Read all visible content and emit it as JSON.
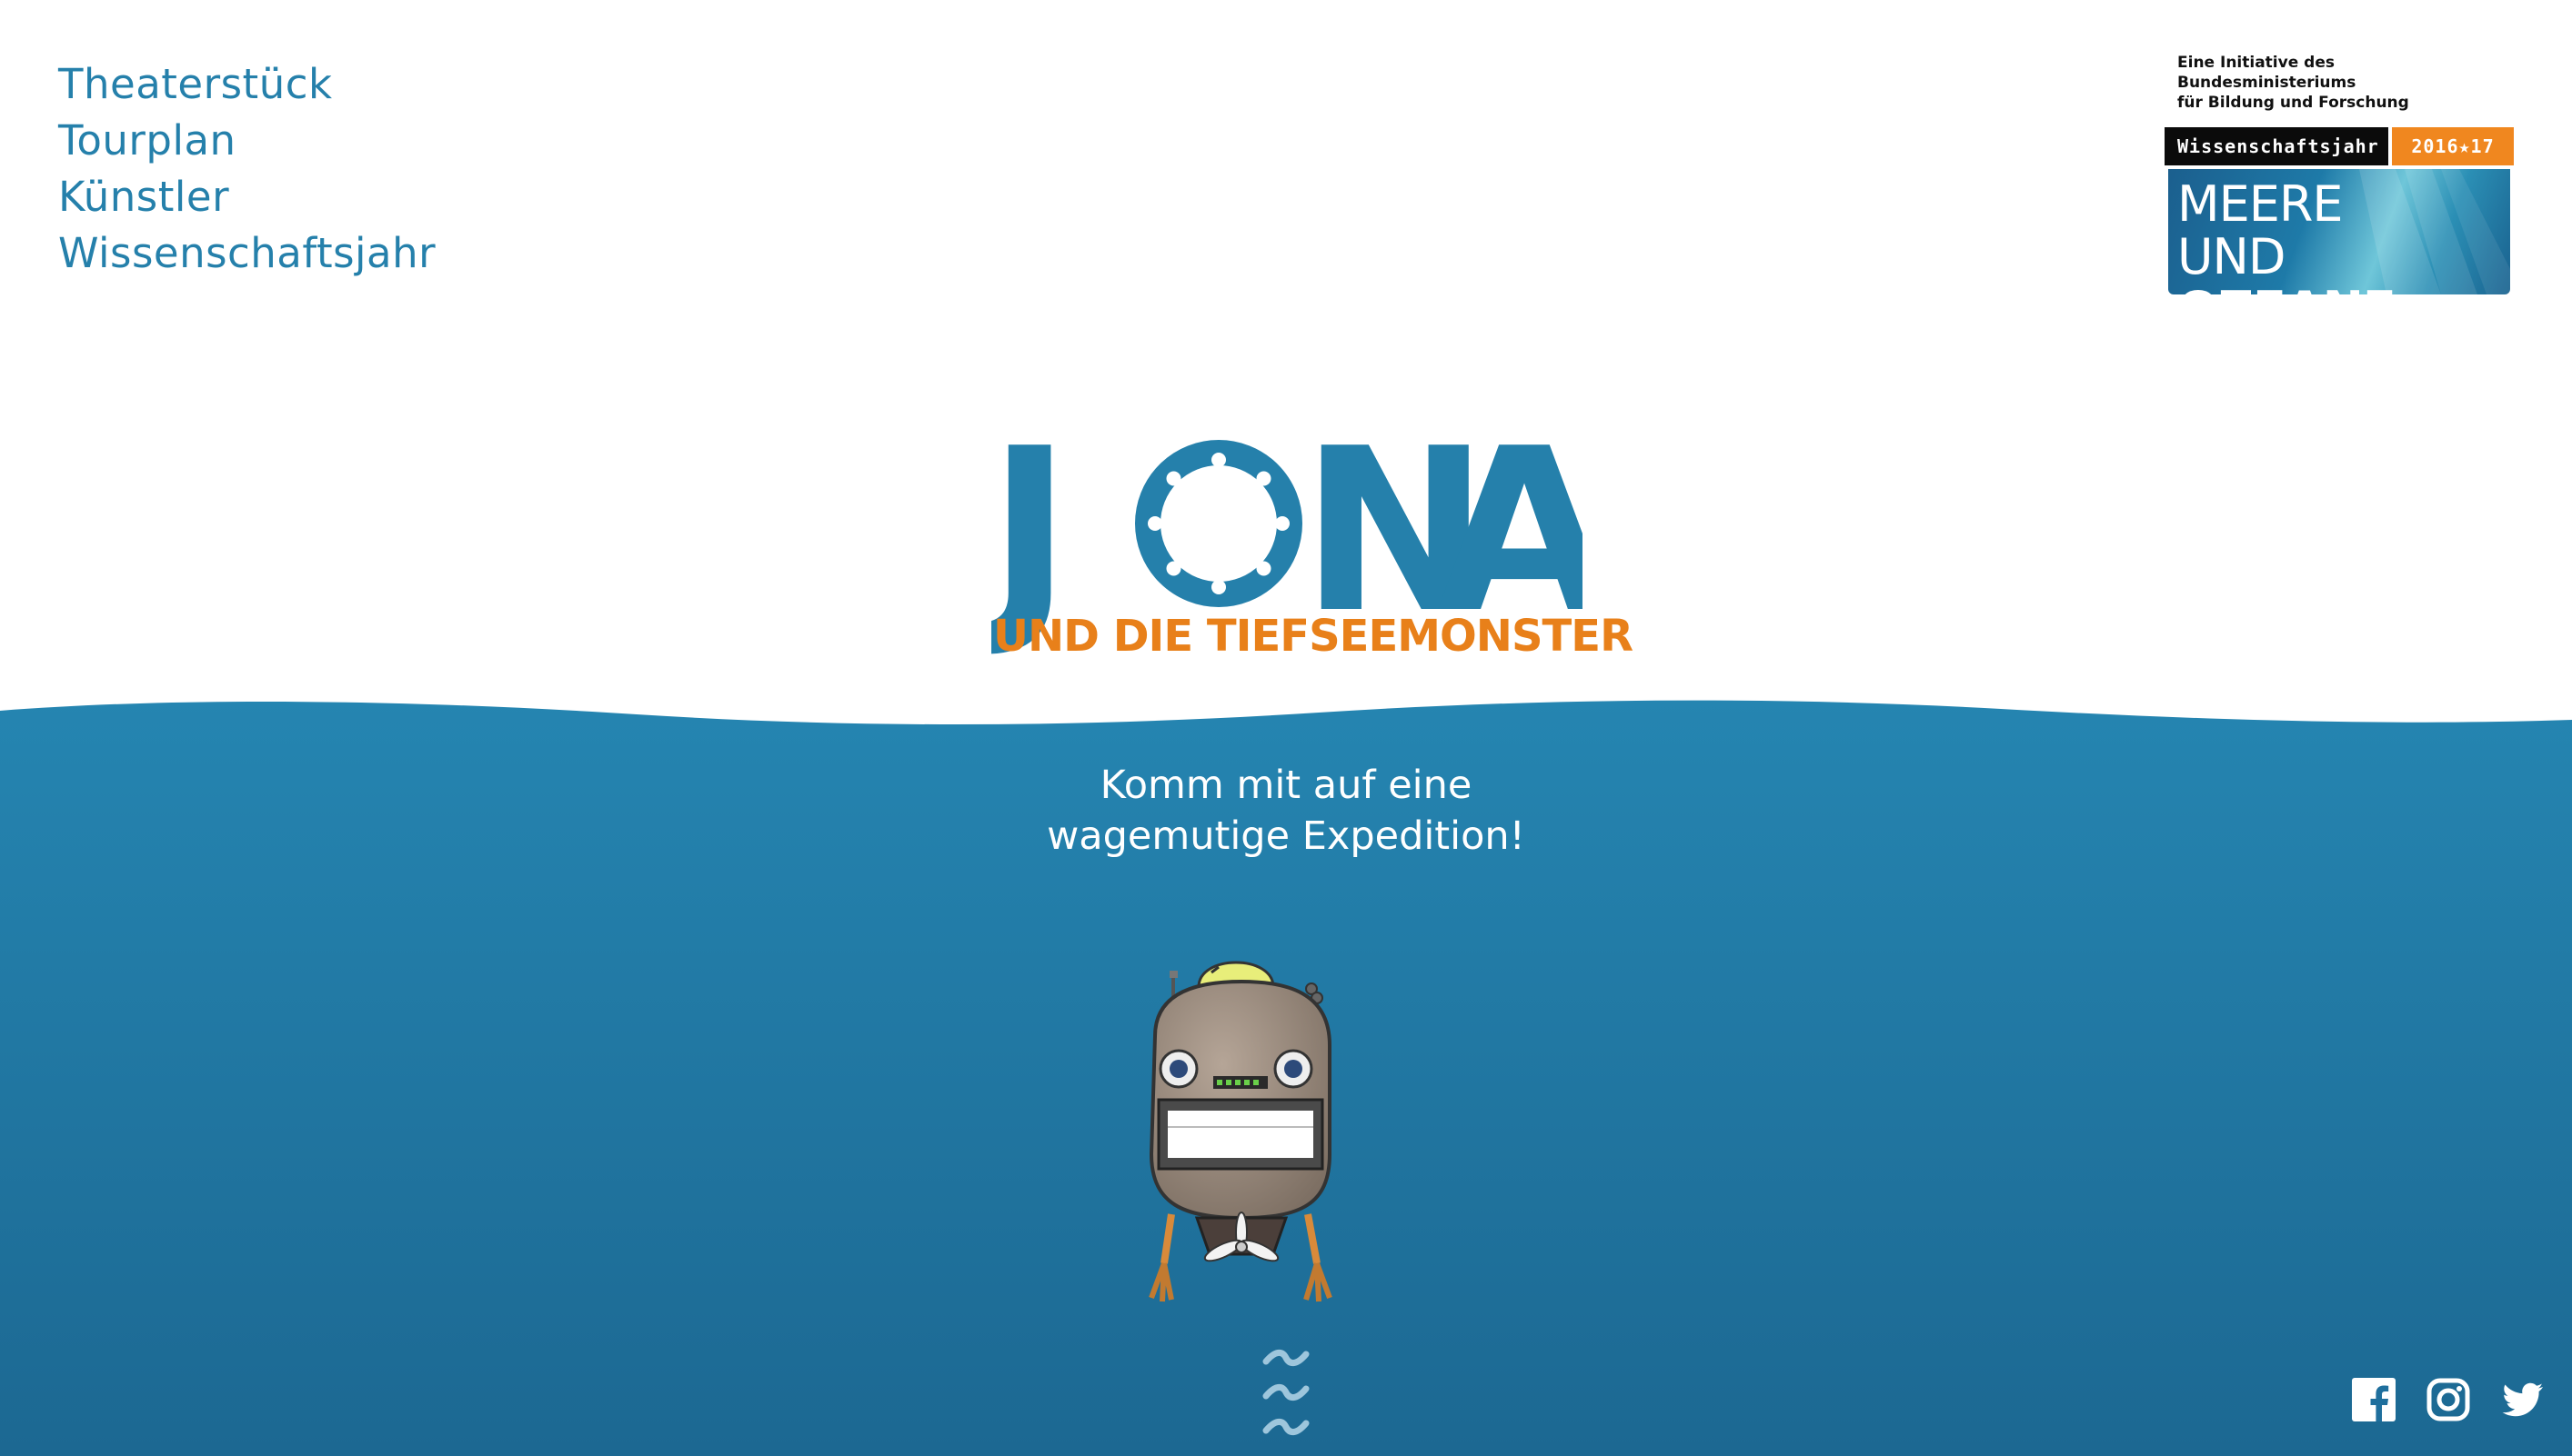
{
  "nav": {
    "items": [
      {
        "label": "Theaterstück"
      },
      {
        "label": "Tourplan"
      },
      {
        "label": "Künstler"
      },
      {
        "label": "Wissenschaftsjahr"
      }
    ]
  },
  "sponsor": {
    "initiative_line1": "Eine Initiative des Bundesministeriums",
    "initiative_line2": "für Bildung und Forschung",
    "bar_left": "Wissenschaftsjahr",
    "bar_right": "2016★17",
    "box_line1": "MEERE",
    "box_line2a": "UND ",
    "box_line2b": "OZEANE"
  },
  "hero": {
    "title_letters": [
      "J",
      "N",
      "A"
    ],
    "subtitle": "UND DIE TIEFSEEMONSTER",
    "tagline_line1": "Komm mit auf eine",
    "tagline_line2": "wagemutige Expedition!"
  },
  "icons": {
    "facebook": "facebook-icon",
    "instagram": "instagram-icon",
    "twitter": "twitter-icon",
    "scroll": "wave-scroll-icon"
  },
  "colors": {
    "brand_blue": "#2580ab",
    "accent_orange": "#e8801a",
    "water_top": "#2585b1",
    "water_bottom": "#1c6892"
  }
}
